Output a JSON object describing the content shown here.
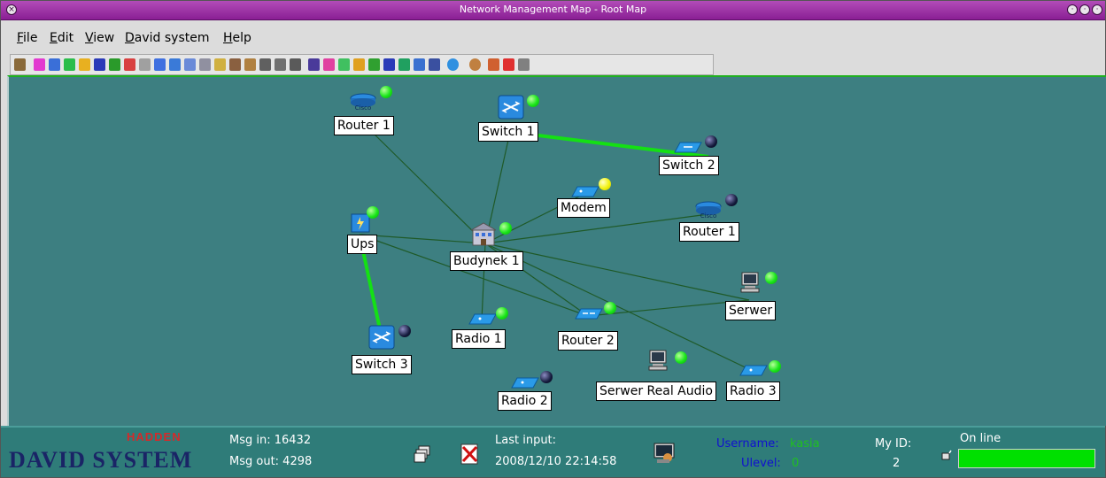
{
  "window": {
    "title": "Network Management Map - Root Map"
  },
  "menubar": [
    {
      "label": "File",
      "mnemonic": "F",
      "rest": "ile"
    },
    {
      "label": "Edit",
      "mnemonic": "E",
      "rest": "dit"
    },
    {
      "label": "View",
      "mnemonic": "V",
      "rest": "iew"
    },
    {
      "label": "David system",
      "mnemonic": "D",
      "rest": "avid system"
    },
    {
      "label": "Help",
      "mnemonic": "H",
      "rest": "elp"
    }
  ],
  "map": {
    "nodes": {
      "router1_top": {
        "label": "Router 1",
        "icon": "cisco-router-icon",
        "status": "green"
      },
      "switch1": {
        "label": "Switch 1",
        "icon": "switch-icon",
        "status": "green"
      },
      "switch2": {
        "label": "Switch 2",
        "icon": "switch-flat-icon",
        "status": "black"
      },
      "modem": {
        "label": "Modem",
        "icon": "modem-icon",
        "status": "yellow"
      },
      "router1_right": {
        "label": "Router 1",
        "icon": "cisco-router-icon",
        "status": "black"
      },
      "ups": {
        "label": "Ups",
        "icon": "ups-icon",
        "status": "green"
      },
      "budynek1": {
        "label": "Budynek 1",
        "icon": "building-icon",
        "status": "green"
      },
      "serwer": {
        "label": "Serwer",
        "icon": "computer-icon",
        "status": "green"
      },
      "radio1": {
        "label": "Radio 1",
        "icon": "radio-icon",
        "status": "green"
      },
      "router2": {
        "label": "Router 2",
        "icon": "router-icon",
        "status": "green"
      },
      "switch3": {
        "label": "Switch 3",
        "icon": "switch-icon",
        "status": "black"
      },
      "radio2": {
        "label": "Radio 2",
        "icon": "radio-icon",
        "status": "black"
      },
      "serwer_real_audio": {
        "label": "Serwer Real Audio",
        "icon": "computer-icon",
        "status": "green"
      },
      "radio3": {
        "label": "Radio 3",
        "icon": "radio-icon",
        "status": "green"
      }
    },
    "links": [
      {
        "from": "router1_top",
        "to": "budynek1",
        "kind": "normal"
      },
      {
        "from": "switch1",
        "to": "budynek1",
        "kind": "normal"
      },
      {
        "from": "switch1",
        "to": "switch2",
        "kind": "highlight"
      },
      {
        "from": "modem",
        "to": "budynek1",
        "kind": "normal"
      },
      {
        "from": "router1_right",
        "to": "budynek1",
        "kind": "normal"
      },
      {
        "from": "ups",
        "to": "budynek1",
        "kind": "normal"
      },
      {
        "from": "ups",
        "to": "router2",
        "kind": "normal"
      },
      {
        "from": "ups",
        "to": "switch3",
        "kind": "highlight"
      },
      {
        "from": "budynek1",
        "to": "serwer",
        "kind": "normal"
      },
      {
        "from": "budynek1",
        "to": "radio1",
        "kind": "normal"
      },
      {
        "from": "budynek1",
        "to": "router2",
        "kind": "normal"
      },
      {
        "from": "budynek1",
        "to": "radio3",
        "kind": "normal"
      },
      {
        "from": "router2",
        "to": "serwer",
        "kind": "normal"
      }
    ]
  },
  "statusbar": {
    "logo_top": "HADDEN",
    "logo_main": "DAVID SYSTEM",
    "msg_in": "Msg in: 16432",
    "msg_out": "Msg out: 4298",
    "last_input_label": "Last input:",
    "last_input_value": "2008/12/10 22:14:58",
    "username_label": "Username:",
    "username_value": "kasia",
    "ulevel_label": "Ulevel:",
    "ulevel_value": "0",
    "my_id_label": "My ID:",
    "my_id_value": "2",
    "online_label": "On line"
  },
  "colors": {
    "map_background": "#3d7f81",
    "link_normal": "#1f5a28",
    "link_highlight": "#14e014",
    "title_bar": "#9a2ea4",
    "status_green": "#19e619",
    "status_black": "#141a3c",
    "status_yellow": "#f2f20f",
    "username_blue": "#1010d0",
    "username_value_green": "#20c020"
  }
}
